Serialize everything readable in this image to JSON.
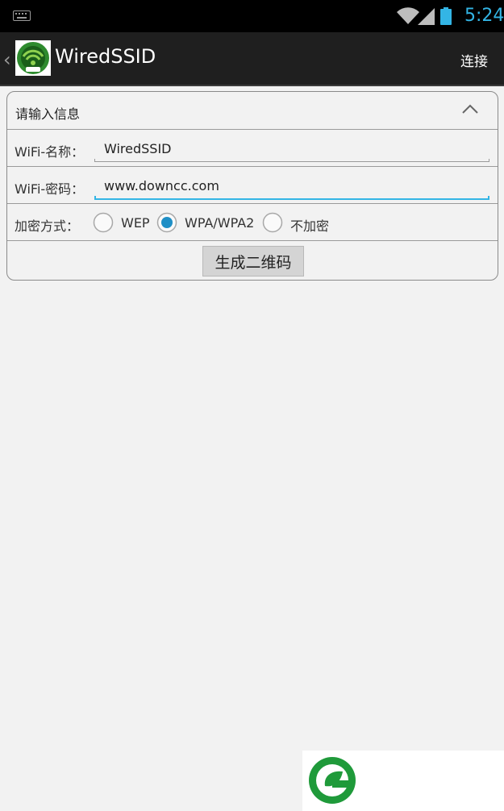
{
  "status_bar": {
    "time": "5:24",
    "icons": [
      "keyboard-icon",
      "wifi-icon",
      "signal-icon",
      "battery-icon"
    ],
    "time_color": "#33b5e5"
  },
  "action_bar": {
    "title": "WiredSSID",
    "action_label": "连接",
    "icons": [
      "back-chevron-icon",
      "app-icon"
    ]
  },
  "form": {
    "header": "请输入信息",
    "ssid_label": "WiFi-名称：",
    "ssid_value": "WiredSSID",
    "password_label": "WiFi-密码：",
    "password_value": "www.downcc.com",
    "encryption_label": "加密方式：",
    "encryption_options": [
      {
        "label": "WEP",
        "selected": false
      },
      {
        "label": "WPA/WPA2",
        "selected": true
      },
      {
        "label": "不加密",
        "selected": false
      }
    ],
    "generate_button": "生成二维码"
  },
  "colors": {
    "accent": "#33b5e5",
    "action_bar_bg": "#1f1f1f",
    "page_bg": "#f2f2f2"
  }
}
